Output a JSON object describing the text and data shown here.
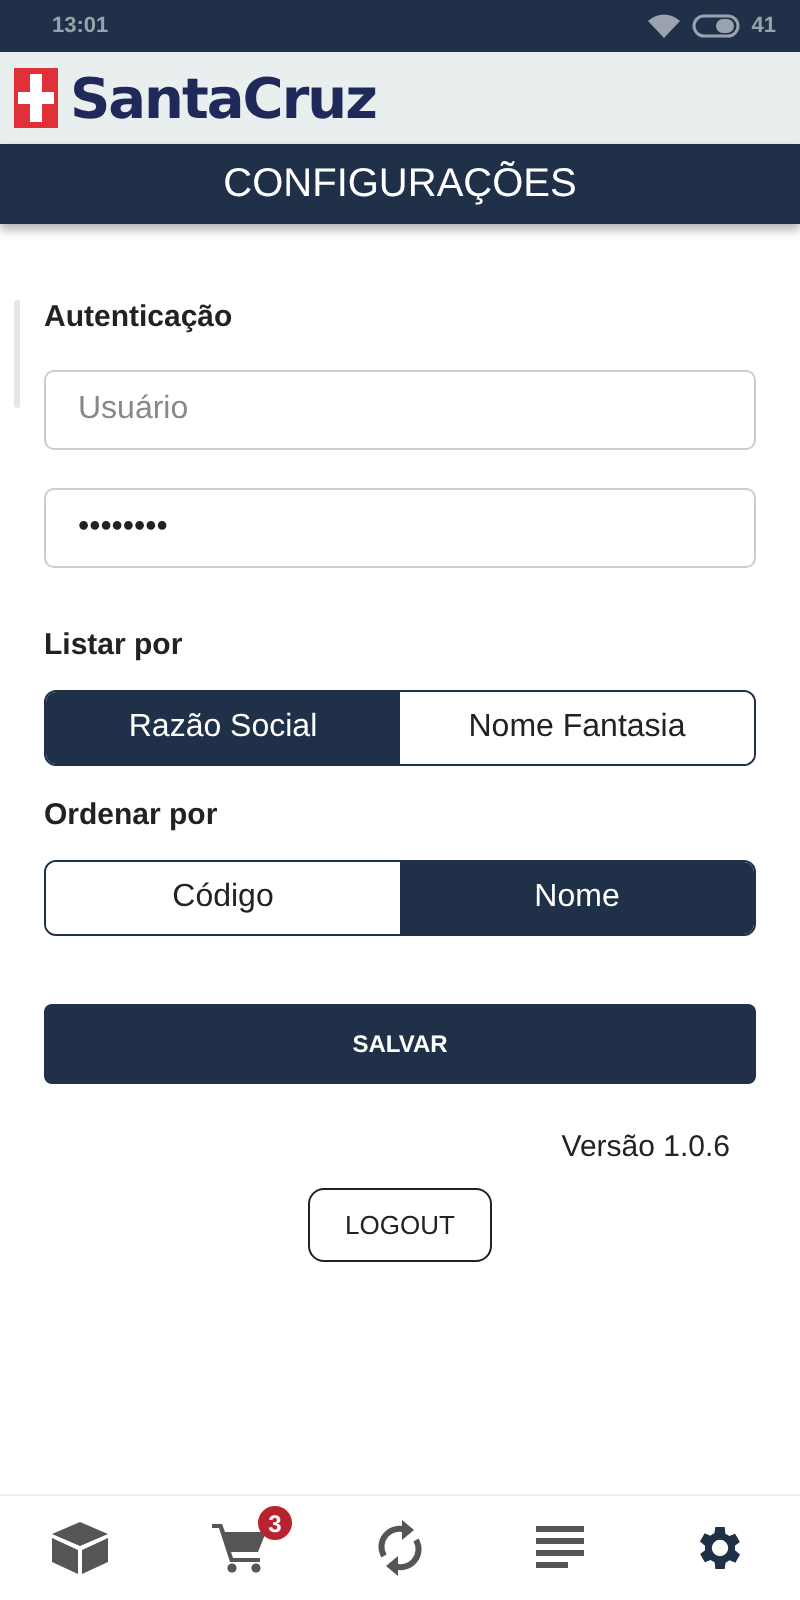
{
  "status_bar": {
    "time": "13:01",
    "battery": "41"
  },
  "header": {
    "logo": "SantaCruz"
  },
  "title": "CONFIGURAÇÕES",
  "auth": {
    "label": "Autenticação",
    "user": {
      "placeholder": "Usuário"
    },
    "password": {
      "value": "••••••••"
    }
  },
  "list_by": {
    "label": "Listar por",
    "options": [
      {
        "label": "Razão Social",
        "selected": true
      },
      {
        "label": "Nome Fantasia",
        "selected": false
      }
    ]
  },
  "order_by": {
    "label": "Ordenar por",
    "options": [
      {
        "label": "Código",
        "selected": false
      },
      {
        "label": "Nome",
        "selected": true
      }
    ]
  },
  "save_button": "SALVAR",
  "version": "Versão 1.0.6",
  "logout_button": "LOGOUT",
  "nav": [
    {
      "kind": "box",
      "selected": false
    },
    {
      "kind": "cart",
      "selected": false,
      "badge": "3"
    },
    {
      "kind": "sync",
      "selected": false
    },
    {
      "kind": "list",
      "selected": false
    },
    {
      "kind": "gear",
      "selected": true
    }
  ]
}
